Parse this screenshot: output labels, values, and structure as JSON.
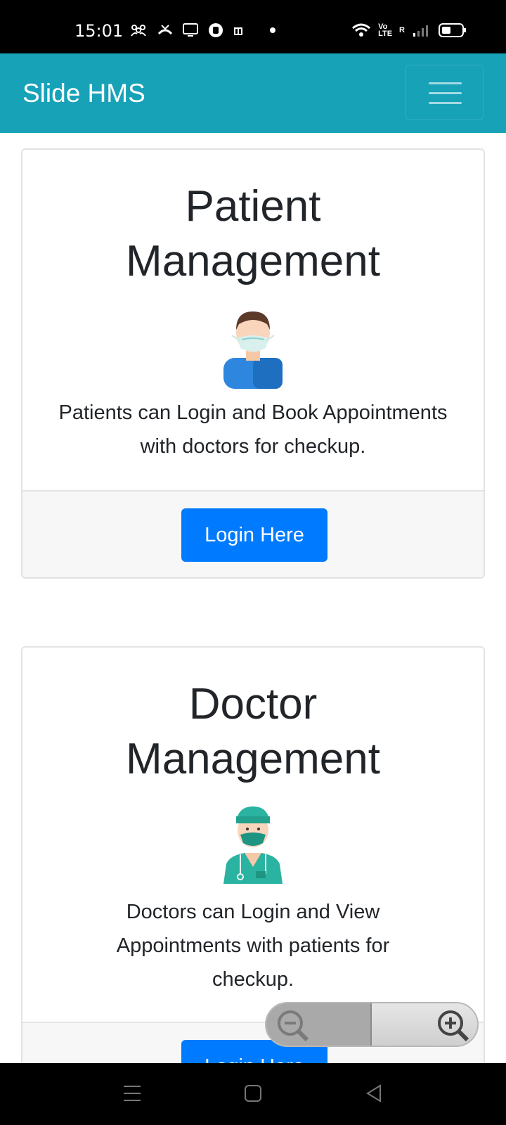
{
  "status_bar": {
    "time": "15:01",
    "lte_top": "Vo",
    "lte_bottom": "LTE",
    "signal_label": "R"
  },
  "navbar": {
    "brand": "Slide HMS"
  },
  "cards": [
    {
      "title": "Patient\nManagement",
      "text": "Patients can Login and Book Appointments with doctors for checkup.",
      "button": "Login Here"
    },
    {
      "title": "Doctor\nManagement",
      "text": "Doctors can Login and View Appointments with patients for checkup.",
      "button": "Login Here"
    }
  ],
  "colors": {
    "navbar": "#17a2b8",
    "button": "#007bff",
    "text": "#212529"
  }
}
